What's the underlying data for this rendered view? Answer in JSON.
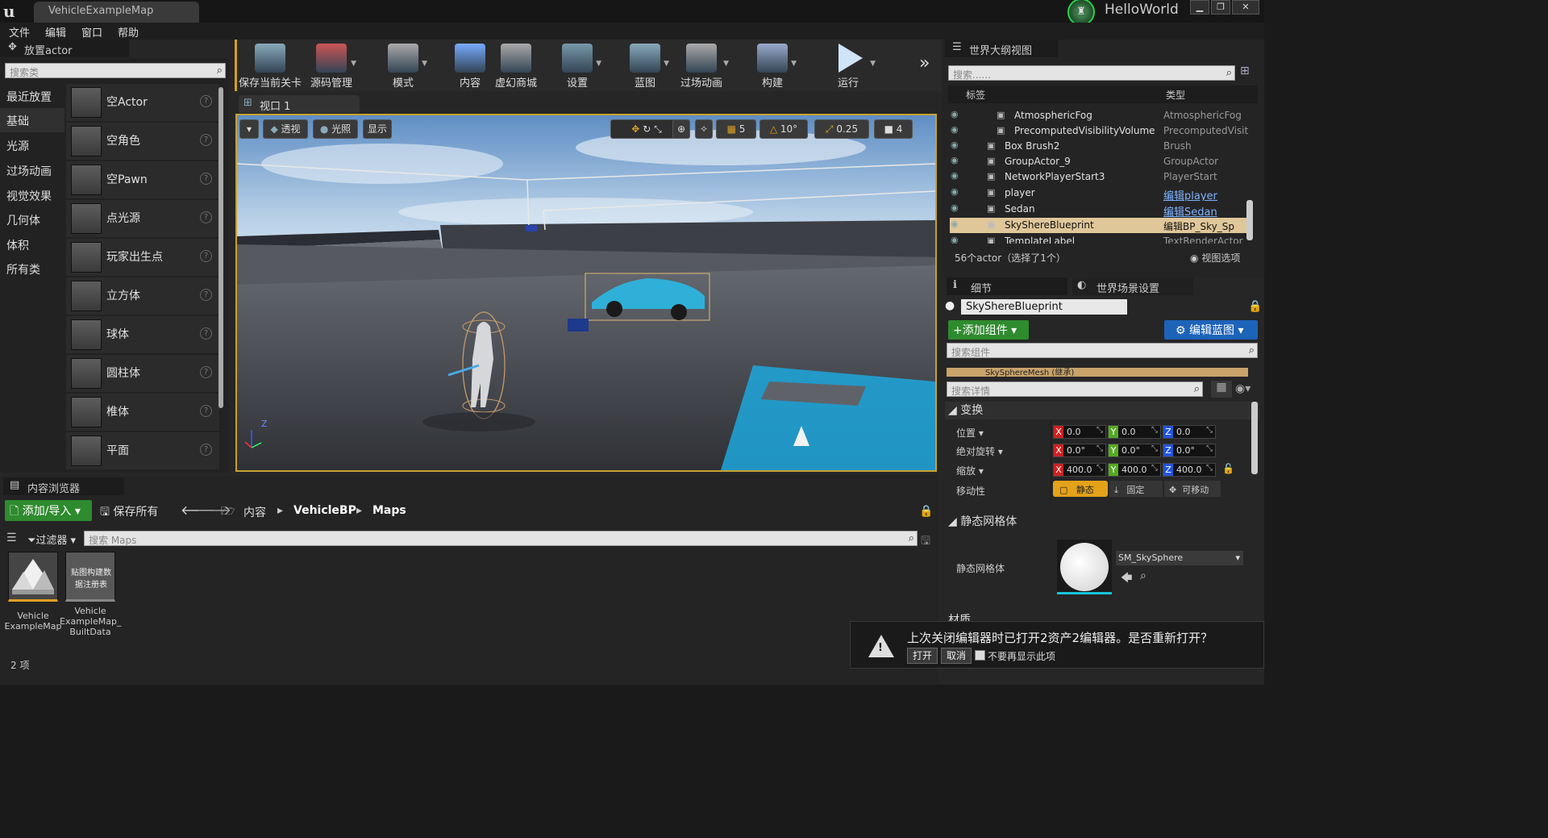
{
  "window": {
    "doc_tab": "VehicleExampleMap",
    "user": "HelloWorld",
    "logo": "u",
    "orb": "♜",
    "min": "▁",
    "max": "❐",
    "close": "✕"
  },
  "menu": [
    "文件",
    "编辑",
    "窗口",
    "帮助"
  ],
  "place": {
    "title": "放置actor",
    "search": "搜索类",
    "categories": [
      "最近放置",
      "基础",
      "光源",
      "过场动画",
      "视觉效果",
      "几何体",
      "体积",
      "所有类"
    ],
    "items": [
      "空Actor",
      "空角色",
      "空Pawn",
      "点光源",
      "玩家出生点",
      "立方体",
      "球体",
      "圆柱体",
      "椎体",
      "平面"
    ]
  },
  "toolbar": [
    "保存当前关卡",
    "源码管理",
    "模式",
    "内容",
    "虚幻商城",
    "设置",
    "蓝图",
    "过场动画",
    "构建",
    "运行"
  ],
  "toolbar_more": "»",
  "viewport": {
    "tab": "视口 1",
    "perspective": "透视",
    "lit": "光照",
    "show": "显示",
    "grid": "5",
    "angle": "10°",
    "scale": "0.25",
    "speed": "4",
    "tab_icon": "⊞",
    "eye_icon": "◆",
    "light_icon": "●",
    "dd": "▾",
    "axis_z": "Z"
  },
  "outliner": {
    "title": "世界大纲视图",
    "search": "搜索......",
    "col_label": "标签",
    "col_type": "类型",
    "rows": [
      {
        "name": "AtmosphericFog",
        "type": "AtmosphericFog",
        "link": false
      },
      {
        "name": "PrecomputedVisibilityVolume",
        "type": "PrecomputedVisit",
        "link": false
      },
      {
        "name": "Box Brush2",
        "type": "Brush",
        "link": false
      },
      {
        "name": "GroupActor_9",
        "type": "GroupActor",
        "link": false
      },
      {
        "name": "NetworkPlayerStart3",
        "type": "PlayerStart",
        "link": false
      },
      {
        "name": "player",
        "type": "编辑player",
        "link": true
      },
      {
        "name": "Sedan",
        "type": "编辑Sedan",
        "link": true
      },
      {
        "name": "SkyShereBlueprint",
        "type": "编辑BP_Sky_Sp",
        "link": false
      },
      {
        "name": "TemplateLabel",
        "type": "TextRenderActor",
        "link": false
      }
    ],
    "footer": "56个actor（选择了1个）",
    "view_options": "视图选项"
  },
  "details": {
    "tab1": "细节",
    "tab2": "世界场景设置",
    "actor": "SkyShereBlueprint",
    "add_component": "+添加组件",
    "edit_bp": "编辑蓝图",
    "search_comp": "搜索组件",
    "component": "SkySphereMesh (继承)",
    "search_details": "搜索详情",
    "transform": "变换",
    "location": "位置",
    "rotation": "绝对旋转",
    "scale": "缩放",
    "mobility": "移动性",
    "loc": [
      "0.0",
      "0.0",
      "0.0"
    ],
    "rot": [
      "0.0°",
      "0.0°",
      "0.0°"
    ],
    "scl": [
      "400.0",
      "400.0",
      "400.0"
    ],
    "mob": [
      "静态",
      "固定",
      "可移动"
    ],
    "static_mesh_section": "静态网格体",
    "static_mesh": "静态网格体",
    "mesh_name": "SM_SkySphere",
    "material": "材质"
  },
  "content": {
    "title": "内容浏览器",
    "add": "添加/导入",
    "save_all": "保存所有",
    "path": [
      "内容",
      "VehicleBP",
      "Maps"
    ],
    "filter": "过滤器",
    "search": "搜索 Maps",
    "count": "2 项",
    "assets": [
      {
        "cap": "Vehicle ExampleMap",
        "thumb": ""
      },
      {
        "cap": "Vehicle ExampleMap_ BuiltData",
        "thumb": "贴图构建数据注册表"
      }
    ]
  },
  "toast": {
    "msg": "上次关闭编辑器时已打开2资产2编辑器。是否重新打开？",
    "open": "打开",
    "cancel": "取消",
    "dont_show": "不要再显示此项",
    "warn": "!"
  }
}
